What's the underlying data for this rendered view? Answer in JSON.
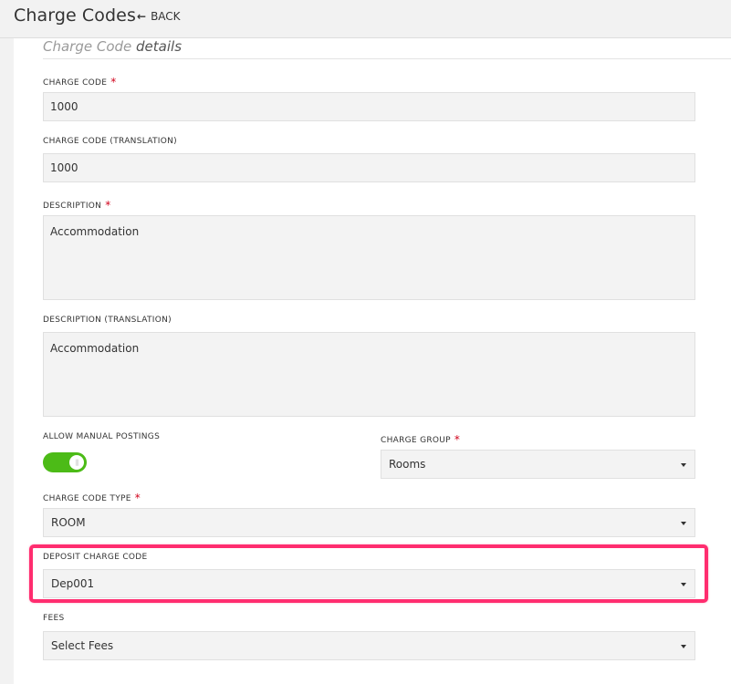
{
  "header": {
    "title": "Charge Codes",
    "back_label": "BACK"
  },
  "section": {
    "title_part1": "Charge Code",
    "title_part2": " details"
  },
  "required_marker": "*",
  "fields": {
    "charge_code": {
      "label": "CHARGE CODE",
      "value": "1000",
      "required": true
    },
    "charge_code_translation": {
      "label": "CHARGE CODE (TRANSLATION)",
      "value": "1000"
    },
    "description": {
      "label": "DESCRIPTION",
      "value": "Accommodation",
      "required": true
    },
    "description_translation": {
      "label": "DESCRIPTION (TRANSLATION)",
      "value": "Accommodation"
    },
    "allow_manual_postings": {
      "label": "ALLOW MANUAL POSTINGS",
      "on": true,
      "on_color": "#4cbb17"
    },
    "charge_group": {
      "label": "CHARGE GROUP",
      "value": "Rooms",
      "required": true
    },
    "charge_code_type": {
      "label": "CHARGE CODE TYPE",
      "value": "ROOM",
      "required": true
    },
    "deposit_charge_code": {
      "label": "DEPOSIT CHARGE CODE",
      "value": "Dep001"
    },
    "fees": {
      "label": "FEES",
      "value": "Select Fees"
    }
  },
  "colors": {
    "highlight": "#ff2d6f",
    "required": "#d0021b",
    "input_bg": "#f3f3f3"
  }
}
